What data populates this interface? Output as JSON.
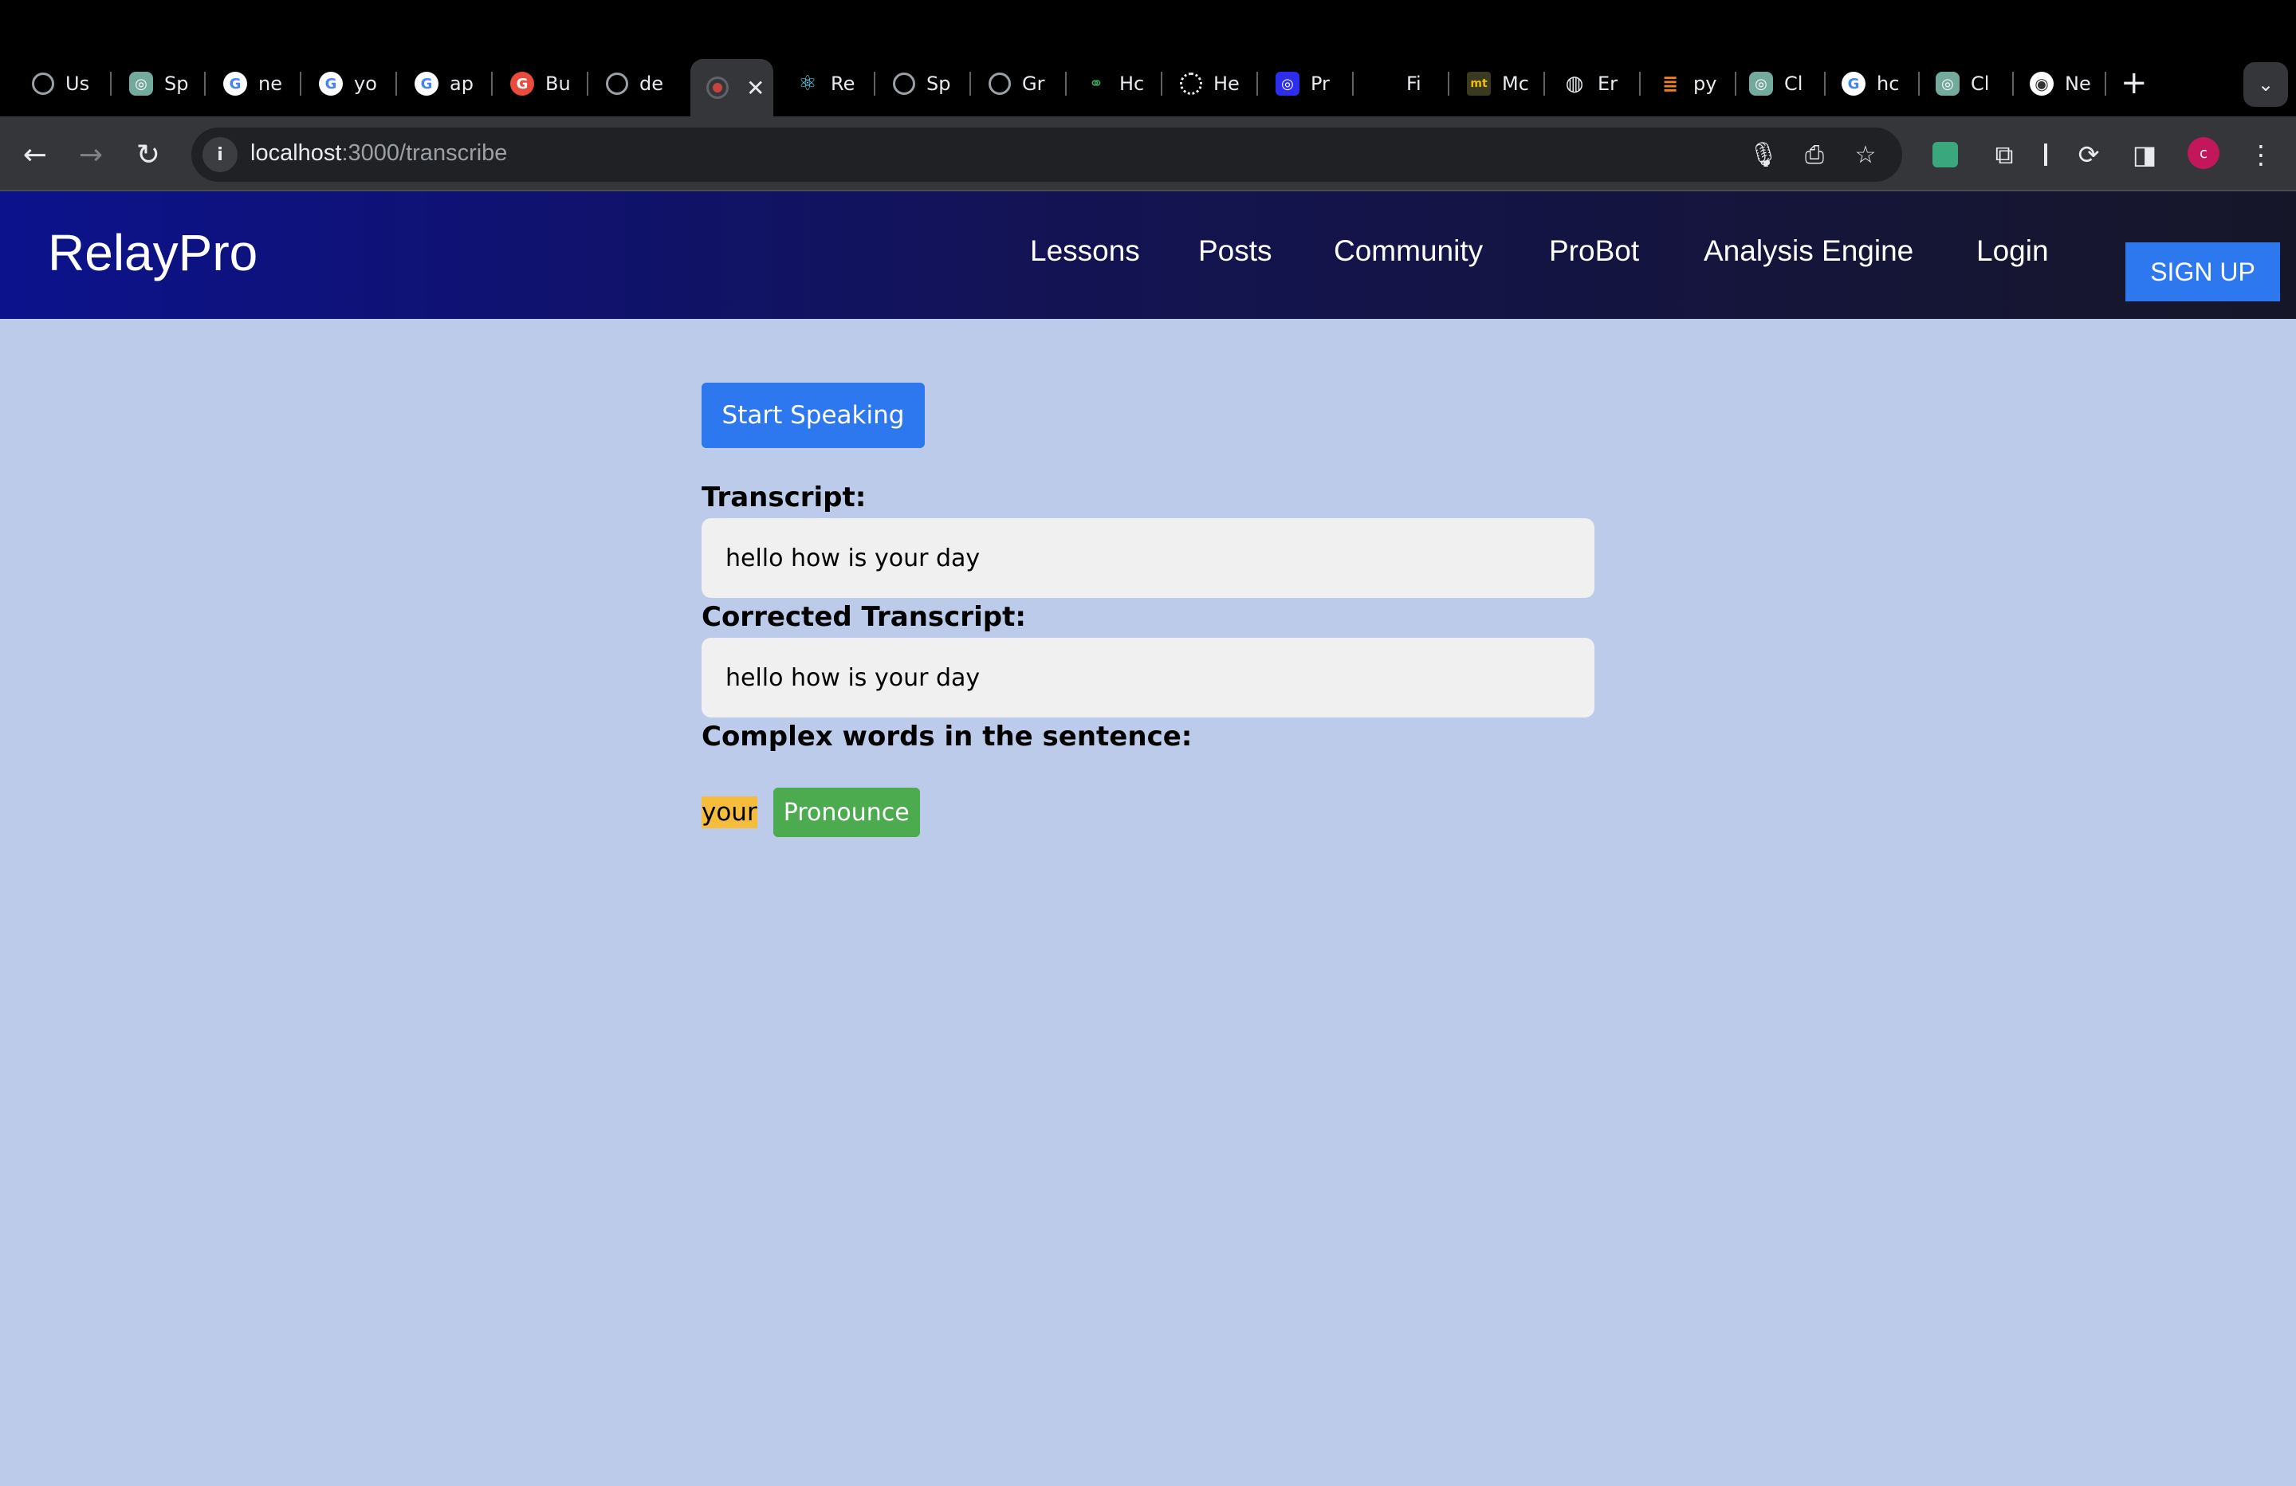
{
  "browser": {
    "tabs": [
      {
        "label": "Us",
        "icon": "chatgpt-icon",
        "color": "#5f6368"
      },
      {
        "label": "Sp",
        "icon": "chatgpt-icon",
        "color": "#74aa9c"
      },
      {
        "label": "ne",
        "icon": "google-icon",
        "color": "#4285f4"
      },
      {
        "label": "yo",
        "icon": "google-icon",
        "color": "#4285f4"
      },
      {
        "label": "ap",
        "icon": "google-icon",
        "color": "#4285f4"
      },
      {
        "label": "Bu",
        "icon": "grammarly-icon",
        "color": "#e94b3c"
      },
      {
        "label": "de",
        "icon": "chatgpt-icon",
        "color": "#5f6368"
      },
      {
        "label": "Re",
        "icon": "react-icon",
        "color": "#61dafb"
      },
      {
        "label": "Sp",
        "icon": "chatgpt-icon",
        "color": "#5f6368"
      },
      {
        "label": "Gr",
        "icon": "chatgpt-icon",
        "color": "#5f6368"
      },
      {
        "label": "Hc",
        "icon": "link-icon",
        "color": "#2e7d32"
      },
      {
        "label": "He",
        "icon": "loading-icon",
        "color": "#e8eaed"
      },
      {
        "label": "Pr",
        "icon": "openai-icon",
        "color": "#2d2df0"
      },
      {
        "label": "Fi",
        "icon": "blank-icon",
        "color": "#000000"
      },
      {
        "label": "Mc",
        "icon": "mt-icon",
        "color": "#3a3a20"
      },
      {
        "label": "Er",
        "icon": "globe-icon",
        "color": "#e8eaed"
      },
      {
        "label": "py",
        "icon": "stackoverflow-icon",
        "color": "#f48024"
      },
      {
        "label": "Cl",
        "icon": "chatgpt-icon",
        "color": "#74aa9c"
      },
      {
        "label": "hc",
        "icon": "google-icon",
        "color": "#4285f4"
      },
      {
        "label": "Cl",
        "icon": "chatgpt-icon",
        "color": "#74aa9c"
      },
      {
        "label": "Ne",
        "icon": "chrome-icon",
        "color": "#e8eaed"
      }
    ],
    "active_tab_close": "✕",
    "new_tab": "+",
    "url_host": "localhost",
    "url_path": ":3000/transcribe",
    "avatar_letter": "c"
  },
  "app": {
    "brand": "RelayPro",
    "nav": [
      "Lessons",
      "Posts",
      "Community",
      "ProBot",
      "Analysis Engine",
      "Login"
    ],
    "signup": "SIGN UP",
    "accent": "#2d78ef"
  },
  "main": {
    "start_button": "Start Speaking",
    "transcript_label": "Transcript:",
    "transcript_value": "hello how is your day",
    "corrected_label": "Corrected Transcript:",
    "corrected_value": "hello how is your day",
    "complex_label": "Complex words in the sentence:",
    "complex_words": [
      {
        "word": "your",
        "button": "Pronounce"
      }
    ]
  }
}
